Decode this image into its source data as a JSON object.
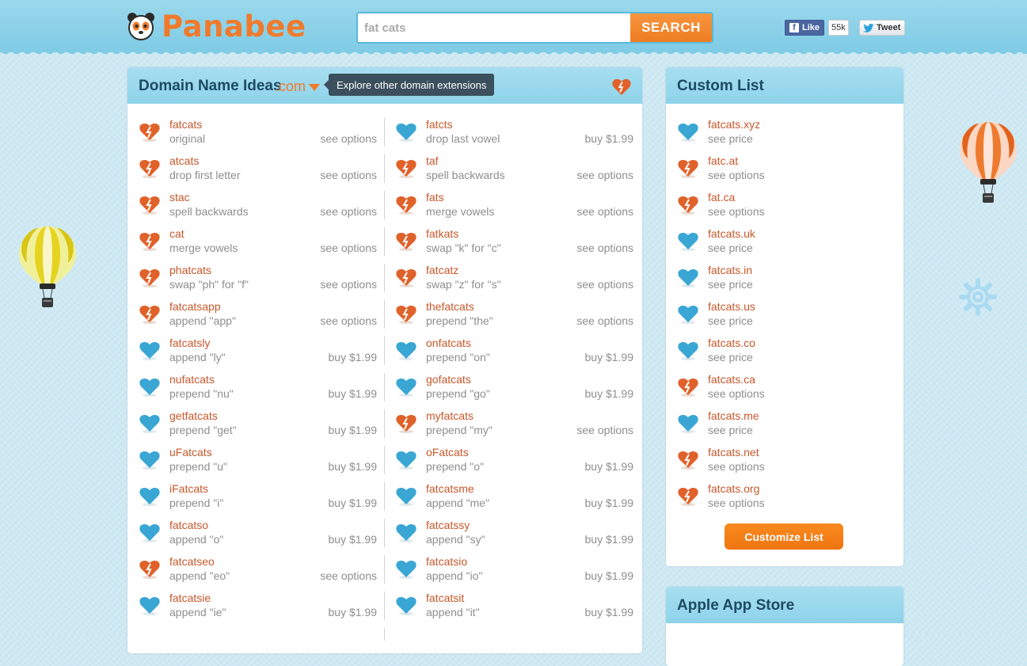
{
  "header": {
    "logo_text": "Panabee",
    "search_value": "fat cats",
    "search_button": "SEARCH",
    "fb_like": "Like",
    "fb_count": "55k",
    "tweet": "Tweet"
  },
  "ideas": {
    "title": "Domain Name Ideas",
    "extension": ".com",
    "tooltip": "Explore other domain extensions",
    "left": [
      {
        "name": "fatcats",
        "desc": "original",
        "action": "see options",
        "status": "taken"
      },
      {
        "name": "atcats",
        "desc": "drop first letter",
        "action": "see options",
        "status": "taken"
      },
      {
        "name": "stac",
        "desc": "spell backwards",
        "action": "see options",
        "status": "taken"
      },
      {
        "name": "cat",
        "desc": "merge vowels",
        "action": "see options",
        "status": "taken"
      },
      {
        "name": "phatcats",
        "desc": "swap \"ph\" for \"f\"",
        "action": "see options",
        "status": "taken"
      },
      {
        "name": "fatcatsapp",
        "desc": "append \"app\"",
        "action": "see options",
        "status": "taken"
      },
      {
        "name": "fatcatsly",
        "desc": "append \"ly\"",
        "action": "buy $1.99",
        "status": "available"
      },
      {
        "name": "nufatcats",
        "desc": "prepend \"nu\"",
        "action": "buy $1.99",
        "status": "available"
      },
      {
        "name": "getfatcats",
        "desc": "prepend \"get\"",
        "action": "buy $1.99",
        "status": "available"
      },
      {
        "name": "uFatcats",
        "desc": "prepend \"u\"",
        "action": "buy $1.99",
        "status": "available"
      },
      {
        "name": "iFatcats",
        "desc": "prepend \"i\"",
        "action": "buy $1.99",
        "status": "available"
      },
      {
        "name": "fatcatso",
        "desc": "append \"o\"",
        "action": "buy $1.99",
        "status": "available"
      },
      {
        "name": "fatcatseo",
        "desc": "append \"eo\"",
        "action": "see options",
        "status": "taken"
      },
      {
        "name": "fatcatsie",
        "desc": "append \"ie\"",
        "action": "buy $1.99",
        "status": "available"
      }
    ],
    "right": [
      {
        "name": "fatcts",
        "desc": "drop last vowel",
        "action": "buy $1.99",
        "status": "available"
      },
      {
        "name": "taf",
        "desc": "spell backwards",
        "action": "see options",
        "status": "taken"
      },
      {
        "name": "fats",
        "desc": "merge vowels",
        "action": "see options",
        "status": "taken"
      },
      {
        "name": "fatkats",
        "desc": "swap \"k\" for \"c\"",
        "action": "see options",
        "status": "taken"
      },
      {
        "name": "fatcatz",
        "desc": "swap \"z\" for \"s\"",
        "action": "see options",
        "status": "taken"
      },
      {
        "name": "thefatcats",
        "desc": "prepend \"the\"",
        "action": "see options",
        "status": "taken"
      },
      {
        "name": "onfatcats",
        "desc": "prepend \"on\"",
        "action": "buy $1.99",
        "status": "available"
      },
      {
        "name": "gofatcats",
        "desc": "prepend \"go\"",
        "action": "buy $1.99",
        "status": "available"
      },
      {
        "name": "myfatcats",
        "desc": "prepend \"my\"",
        "action": "see options",
        "status": "taken"
      },
      {
        "name": "oFatcats",
        "desc": "prepend \"o\"",
        "action": "buy $1.99",
        "status": "available"
      },
      {
        "name": "fatcatsme",
        "desc": "append \"me\"",
        "action": "buy $1.99",
        "status": "available"
      },
      {
        "name": "fatcatssy",
        "desc": "append \"sy\"",
        "action": "buy $1.99",
        "status": "available"
      },
      {
        "name": "fatcatsio",
        "desc": "append \"io\"",
        "action": "buy $1.99",
        "status": "available"
      },
      {
        "name": "fatcatsit",
        "desc": "append \"it\"",
        "action": "buy $1.99",
        "status": "available"
      }
    ]
  },
  "custom": {
    "title": "Custom List",
    "items": [
      {
        "name": "fatcats.xyz",
        "desc": "see price",
        "status": "available"
      },
      {
        "name": "fatc.at",
        "desc": "see options",
        "status": "taken"
      },
      {
        "name": "fat.ca",
        "desc": "see options",
        "status": "taken"
      },
      {
        "name": "fatcats.uk",
        "desc": "see price",
        "status": "available"
      },
      {
        "name": "fatcats.in",
        "desc": "see price",
        "status": "available"
      },
      {
        "name": "fatcats.us",
        "desc": "see price",
        "status": "available"
      },
      {
        "name": "fatcats.co",
        "desc": "see price",
        "status": "available"
      },
      {
        "name": "fatcats.ca",
        "desc": "see options",
        "status": "taken"
      },
      {
        "name": "fatcats.me",
        "desc": "see price",
        "status": "available"
      },
      {
        "name": "fatcats.net",
        "desc": "see options",
        "status": "taken"
      },
      {
        "name": "fatcats.org",
        "desc": "see options",
        "status": "taken"
      }
    ],
    "button": "Customize List"
  },
  "appstore": {
    "title": "Apple App Store"
  },
  "colors": {
    "brand_orange": "#f07a2b",
    "available_blue": "#3aa6d4",
    "taken_orange": "#e0622a"
  }
}
